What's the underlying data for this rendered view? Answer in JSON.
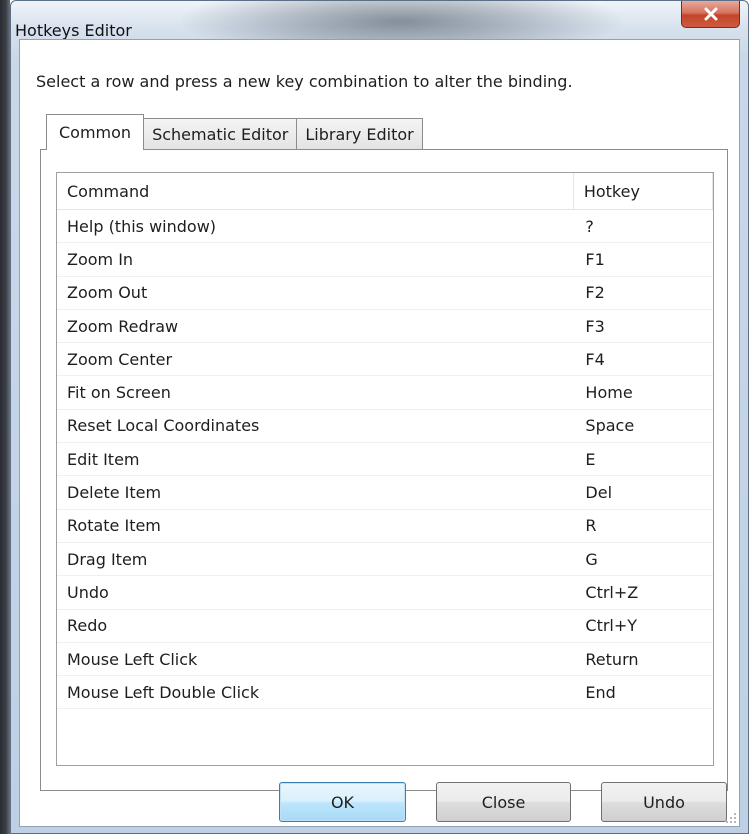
{
  "window": {
    "title": "Hotkeys Editor",
    "close_symbol": "X",
    "close_icon": "close-icon"
  },
  "instruction": "Select a row and press a new key combination to alter the binding.",
  "tabs": [
    {
      "label": "Common",
      "active": true
    },
    {
      "label": "Schematic Editor",
      "active": false
    },
    {
      "label": "Library Editor",
      "active": false
    }
  ],
  "table": {
    "columns": [
      "Command",
      "Hotkey"
    ],
    "rows": [
      {
        "command": "Help (this window)",
        "hotkey": "?"
      },
      {
        "command": "Zoom In",
        "hotkey": "F1"
      },
      {
        "command": "Zoom Out",
        "hotkey": "F2"
      },
      {
        "command": "Zoom Redraw",
        "hotkey": "F3"
      },
      {
        "command": "Zoom Center",
        "hotkey": "F4"
      },
      {
        "command": "Fit on Screen",
        "hotkey": "Home"
      },
      {
        "command": "Reset Local Coordinates",
        "hotkey": "Space"
      },
      {
        "command": "Edit Item",
        "hotkey": "E"
      },
      {
        "command": "Delete Item",
        "hotkey": "Del"
      },
      {
        "command": "Rotate Item",
        "hotkey": "R"
      },
      {
        "command": "Drag Item",
        "hotkey": "G"
      },
      {
        "command": "Undo",
        "hotkey": "Ctrl+Z"
      },
      {
        "command": "Redo",
        "hotkey": "Ctrl+Y"
      },
      {
        "command": "Mouse Left Click",
        "hotkey": "Return"
      },
      {
        "command": "Mouse Left Double Click",
        "hotkey": "End"
      }
    ]
  },
  "buttons": {
    "ok": "OK",
    "close": "Close",
    "undo": "Undo"
  },
  "colors": {
    "close_button": "#c2442a",
    "default_button_border": "#3c7fb1"
  }
}
